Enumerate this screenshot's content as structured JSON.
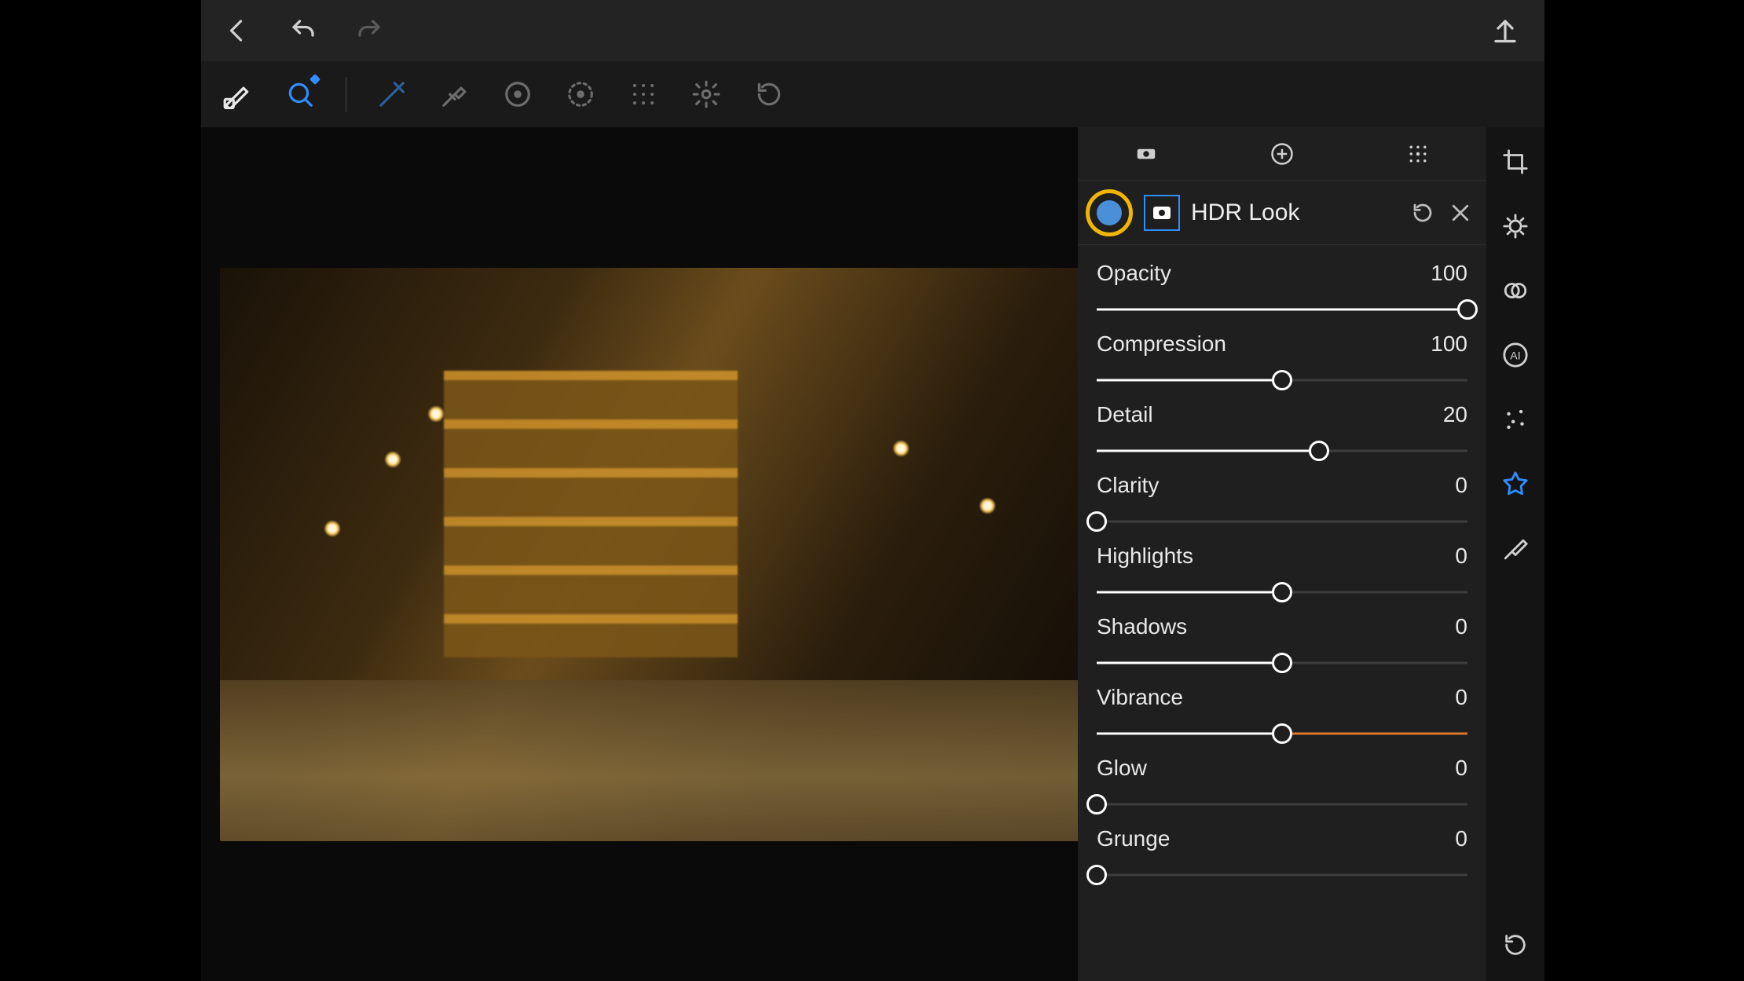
{
  "panel": {
    "title": "HDR Look"
  },
  "sliders": [
    {
      "label": "Opacity",
      "value": 100,
      "min": 0,
      "max": 100,
      "centered": false,
      "pct": 100,
      "tint": ""
    },
    {
      "label": "Compression",
      "value": 100,
      "min": 0,
      "max": 200,
      "centered": true,
      "pct": 50,
      "tint": ""
    },
    {
      "label": "Detail",
      "value": 20,
      "min": -100,
      "max": 100,
      "centered": true,
      "pct": 60,
      "tint": ""
    },
    {
      "label": "Clarity",
      "value": 0,
      "min": 0,
      "max": 100,
      "centered": false,
      "pct": 0,
      "tint": ""
    },
    {
      "label": "Highlights",
      "value": 0,
      "min": -100,
      "max": 100,
      "centered": true,
      "pct": 50,
      "tint": ""
    },
    {
      "label": "Shadows",
      "value": 0,
      "min": -100,
      "max": 100,
      "centered": true,
      "pct": 50,
      "tint": ""
    },
    {
      "label": "Vibrance",
      "value": 0,
      "min": -100,
      "max": 100,
      "centered": true,
      "pct": 50,
      "tint": "#d9772e"
    },
    {
      "label": "Glow",
      "value": 0,
      "min": 0,
      "max": 100,
      "centered": false,
      "pct": 0,
      "tint": ""
    },
    {
      "label": "Grunge",
      "value": 0,
      "min": 0,
      "max": 100,
      "centered": false,
      "pct": 0,
      "tint": ""
    }
  ]
}
